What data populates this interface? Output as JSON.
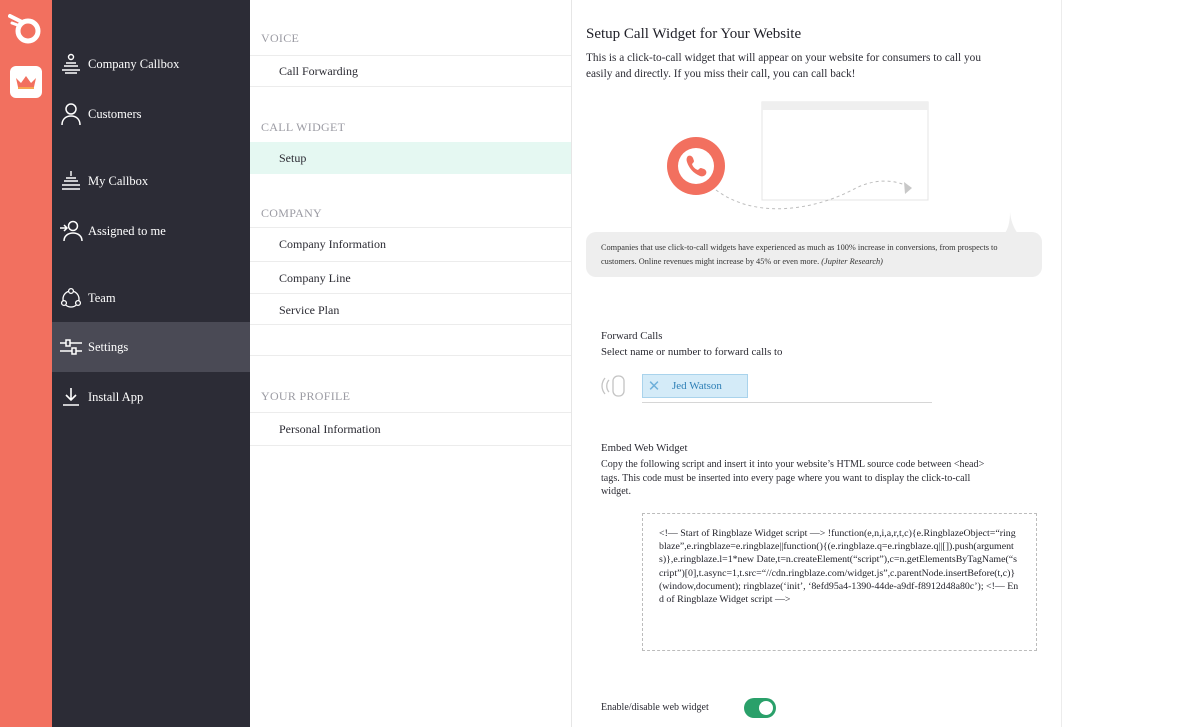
{
  "colors": {
    "brand_coral": "#f2705f",
    "nav_bg": "#2c2c36",
    "nav_active": "#4a4a55",
    "sub_active": "#e5f8f2",
    "chip_bg": "#d4ebf8",
    "toggle_on": "#2aa06a"
  },
  "rail": {
    "logo_icon": "ringblaze-logo-icon",
    "app_icon": "crown-icon"
  },
  "nav": {
    "items": [
      {
        "label": "Company Callbox",
        "icon": "callbox-stack-icon"
      },
      {
        "label": "Customers",
        "icon": "person-icon"
      },
      {
        "label": "My Callbox",
        "icon": "callbox-icon"
      },
      {
        "label": "Assigned to me",
        "icon": "assign-person-icon"
      },
      {
        "label": "Team",
        "icon": "team-icon"
      },
      {
        "label": "Settings",
        "icon": "sliders-icon"
      },
      {
        "label": "Install App",
        "icon": "download-icon"
      }
    ]
  },
  "sub": {
    "sections": [
      {
        "heading": "VOICE",
        "items": [
          "Call Forwarding"
        ]
      },
      {
        "heading": "CALL WIDGET",
        "items": [
          "Setup"
        ]
      },
      {
        "heading": "COMPANY",
        "items": [
          "Company Information",
          "Company Line",
          "Service Plan"
        ]
      },
      {
        "heading": "YOUR PROFILE",
        "items": [
          "Personal Information"
        ]
      }
    ]
  },
  "main": {
    "title": "Setup Call Widget for Your Website",
    "intro": "This is a click-to-call widget that will appear on your website for consumers to call you easily and directly. If you miss their call, you can call back!",
    "stat_text": "Companies that use click-to-call widgets have experienced as much as 100% increase in conversions, from prospects to customers. Online revenues might increase by 45% or even more.",
    "stat_source": "(Jupiter Research)",
    "forward_label": "Forward Calls",
    "forward_sub": "Select name or number to forward calls to",
    "forward_chip": "Jed Watson",
    "embed_label": "Embed Web Widget",
    "embed_desc": "Copy the following script and insert it into your website’s HTML source code between <head> tags. This code must be inserted into every page where you want to display the click-to-call widget.",
    "code": "<!— Start of Ringblaze Widget script —> !function(e,n,i,a,r,t,c){e.RingblazeObject=“ringblaze”,e.ringblaze=e.ringblaze||function(){(e.ringblaze.q=e.ringblaze.q||[]).push(arguments)},e.ringblaze.l=1*new Date,t=n.createElement(“script”),c=n.getElementsByTagName(“script”)[0],t.async=1,t.src=“//cdn.ringblaze.com/widget.js”,c.parentNode.insertBefore(t,c)}(window,document); ringblaze(‘init’, ‘8efd95a4-1390-44de-a9df-f8912d48a80c’); <!— End of Ringblaze Widget script —>",
    "toggle_label": "Enable/disable web widget",
    "toggle_on": true
  }
}
